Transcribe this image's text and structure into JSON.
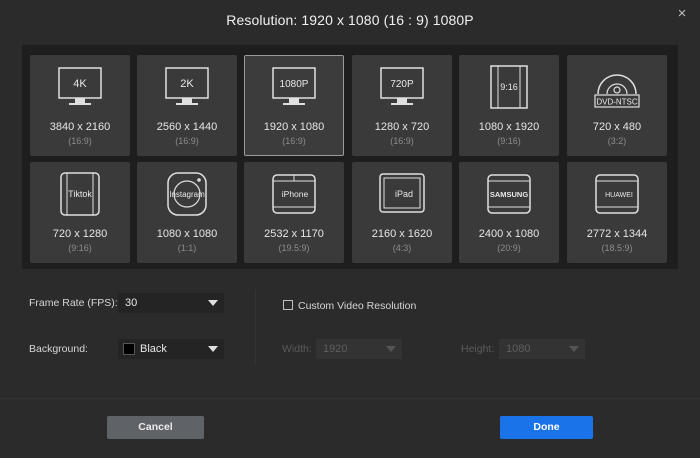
{
  "header": {
    "title": "Resolution: 1920 x 1080    (16 : 9)    1080P",
    "close_glyph": "×"
  },
  "presets": [
    {
      "label": "4K",
      "dims": "3840 x 2160",
      "ratio": "(16:9)",
      "icon": "monitor-icon"
    },
    {
      "label": "2K",
      "dims": "2560 x 1440",
      "ratio": "(16:9)",
      "icon": "monitor-icon"
    },
    {
      "label": "1080P",
      "dims": "1920 x 1080",
      "ratio": "(16:9)",
      "icon": "monitor-icon",
      "selected": true
    },
    {
      "label": "720P",
      "dims": "1280 x 720",
      "ratio": "(16:9)",
      "icon": "monitor-icon"
    },
    {
      "label": "9:16",
      "dims": "1080 x 1920",
      "ratio": "(9:16)",
      "icon": "vertical-frame-icon"
    },
    {
      "label": "DVD-NTSC",
      "dims": "720 x 480",
      "ratio": "(3:2)",
      "icon": "disc-icon"
    },
    {
      "label": "Tiktok",
      "dims": "720 x 1280",
      "ratio": "(9:16)",
      "icon": "phone-icon"
    },
    {
      "label": "Instagram",
      "dims": "1080 x 1080",
      "ratio": "(1:1)",
      "icon": "instagram-icon"
    },
    {
      "label": "iPhone",
      "dims": "2532 x 1170",
      "ratio": "(19.5:9)",
      "icon": "phone-icon"
    },
    {
      "label": "iPad",
      "dims": "2160 x 1620",
      "ratio": "(4:3)",
      "icon": "tablet-icon"
    },
    {
      "label": "SAMSUNG",
      "dims": "2400 x 1080",
      "ratio": "(20:9)",
      "icon": "phone-icon"
    },
    {
      "label": "HUAWEI",
      "dims": "2772 x 1344",
      "ratio": "(18.5:9)",
      "icon": "phone-icon"
    }
  ],
  "settings": {
    "frame_rate_label": "Frame Rate (FPS):",
    "frame_rate_value": "30",
    "background_label": "Background:",
    "background_value": "Black",
    "background_color": "#000000",
    "custom_label": "Custom Video Resolution",
    "custom_checked": false,
    "width_label": "Width:",
    "width_value": "1920",
    "height_label": "Height:",
    "height_value": "1080"
  },
  "footer": {
    "cancel_label": "Cancel",
    "done_label": "Done"
  },
  "colors": {
    "accent": "#1a73e8",
    "panel": "#1e1e1e",
    "tile": "#3a3a3a",
    "background": "#2b2b2b"
  }
}
